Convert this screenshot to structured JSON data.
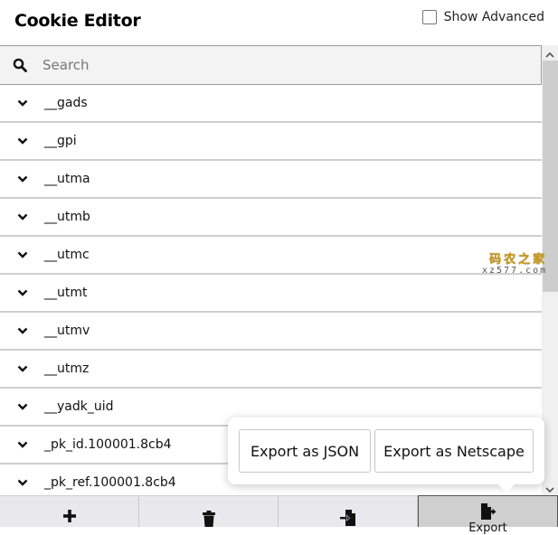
{
  "header": {
    "title": "Cookie Editor",
    "show_advanced_label": "Show Advanced",
    "show_advanced_checked": false
  },
  "search": {
    "placeholder": "Search",
    "value": "",
    "icon": "search-icon"
  },
  "cookies": [
    {
      "name": "__gads"
    },
    {
      "name": "__gpi"
    },
    {
      "name": "__utma"
    },
    {
      "name": "__utmb"
    },
    {
      "name": "__utmc"
    },
    {
      "name": "__utmt"
    },
    {
      "name": "__utmv"
    },
    {
      "name": "__utmz"
    },
    {
      "name": "__yadk_uid"
    },
    {
      "name": "_pk_id.100001.8cb4"
    },
    {
      "name": "_pk_ref.100001.8cb4"
    }
  ],
  "export_popup": {
    "json_label": "Export as JSON",
    "netscape_label": "Export as Netscape"
  },
  "toolbar": {
    "buttons": [
      {
        "icon": "plus-icon",
        "action": "add"
      },
      {
        "icon": "trash-icon",
        "action": "delete"
      },
      {
        "icon": "import-icon",
        "action": "import"
      },
      {
        "icon": "export-icon",
        "action": "export",
        "label": "Export",
        "active": true
      }
    ]
  },
  "watermark": {
    "cn": "码农之家",
    "en": "xz577.com"
  }
}
